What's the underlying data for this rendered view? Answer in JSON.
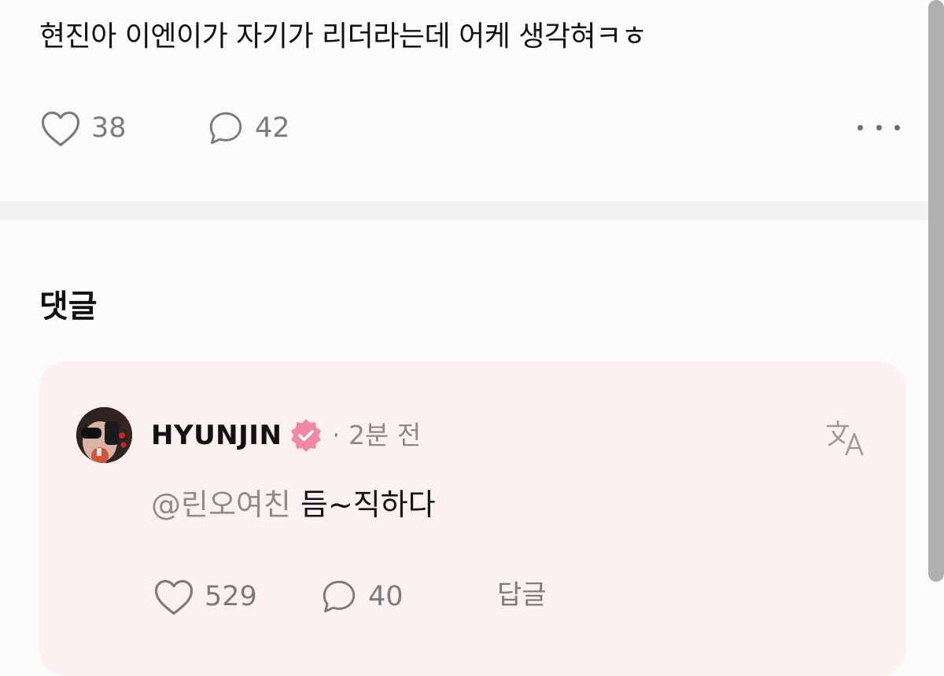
{
  "post": {
    "text": "현진아 이엔이가 자기가 리더라는데 어케 생각혀ㅋㅎ",
    "like_count": "38",
    "comment_count": "42"
  },
  "comments_section": {
    "title": "댓글"
  },
  "comment": {
    "username": "HYUNJIN",
    "time_ago": "· 2분 전",
    "mention": "@린오여친",
    "text": " 듬~직하다",
    "like_count": "529",
    "reply_count": "40",
    "reply_label": "답글"
  },
  "colors": {
    "background": "#fcfbfb",
    "comment_card": "#fdf0f1",
    "verified_badge": "#f08aa2",
    "icon_gray": "#7b7b7b"
  },
  "icons": {
    "like": "heart-icon",
    "comment": "speech-bubble-icon",
    "more": "more-dots-icon",
    "verified": "verified-badge-icon",
    "translate": "translate-icon"
  }
}
